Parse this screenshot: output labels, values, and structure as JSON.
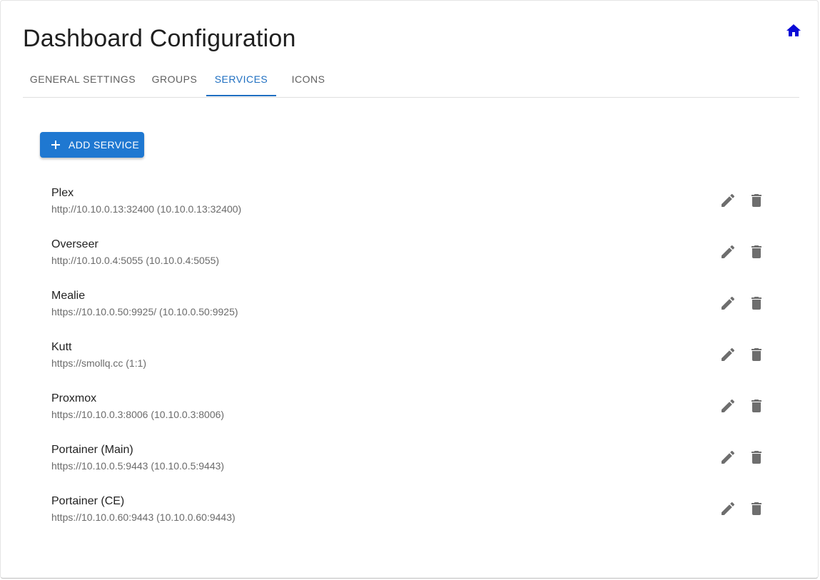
{
  "header": {
    "title": "Dashboard Configuration",
    "home_icon": "home-icon",
    "home_icon_color": "#0a0ad6"
  },
  "tabs": [
    {
      "label": "GENERAL SETTINGS",
      "active": false
    },
    {
      "label": "GROUPS",
      "active": false
    },
    {
      "label": "SERVICES",
      "active": true
    },
    {
      "label": "ICONS",
      "active": false
    }
  ],
  "colors": {
    "accent": "#1f6fc1",
    "button_bg": "#1f78d1",
    "icon_gray": "#6e6e6e"
  },
  "add_button": {
    "label": "ADD SERVICE",
    "icon": "plus-icon"
  },
  "services": [
    {
      "name": "Plex",
      "url": "http://10.10.0.13:32400 (10.10.0.13:32400)"
    },
    {
      "name": "Overseer",
      "url": "http://10.10.0.4:5055 (10.10.0.4:5055)"
    },
    {
      "name": "Mealie",
      "url": "https://10.10.0.50:9925/ (10.10.0.50:9925)"
    },
    {
      "name": "Kutt",
      "url": "https://smollq.cc (1:1)"
    },
    {
      "name": "Proxmox",
      "url": "https://10.10.0.3:8006 (10.10.0.3:8006)"
    },
    {
      "name": "Portainer (Main)",
      "url": "https://10.10.0.5:9443 (10.10.0.5:9443)"
    },
    {
      "name": "Portainer (CE)",
      "url": "https://10.10.0.60:9443 (10.10.0.60:9443)"
    }
  ],
  "row_actions": {
    "edit_icon": "pencil-icon",
    "delete_icon": "trash-icon"
  }
}
